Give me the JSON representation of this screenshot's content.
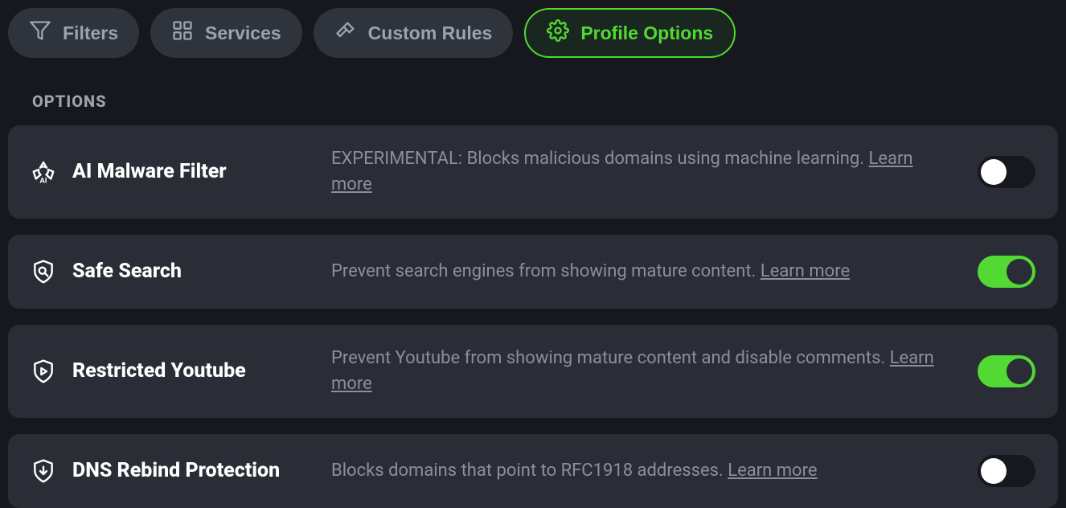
{
  "tabs": {
    "filters": "Filters",
    "services": "Services",
    "custom_rules": "Custom Rules",
    "profile_options": "Profile Options",
    "active": "profile_options"
  },
  "section_label": "OPTIONS",
  "learn_more": "Learn more",
  "options": [
    {
      "id": "ai-malware",
      "title": "AI Malware Filter",
      "desc": "EXPERIMENTAL: Blocks malicious domains using machine learning. ",
      "enabled": false
    },
    {
      "id": "safe-search",
      "title": "Safe Search",
      "desc": "Prevent search engines from showing mature content. ",
      "enabled": true
    },
    {
      "id": "restricted-youtube",
      "title": "Restricted Youtube",
      "desc": "Prevent Youtube from showing mature content and disable comments. ",
      "enabled": true
    },
    {
      "id": "dns-rebind",
      "title": "DNS Rebind Protection",
      "desc": "Blocks domains that point to RFC1918 addresses. ",
      "enabled": false
    }
  ]
}
